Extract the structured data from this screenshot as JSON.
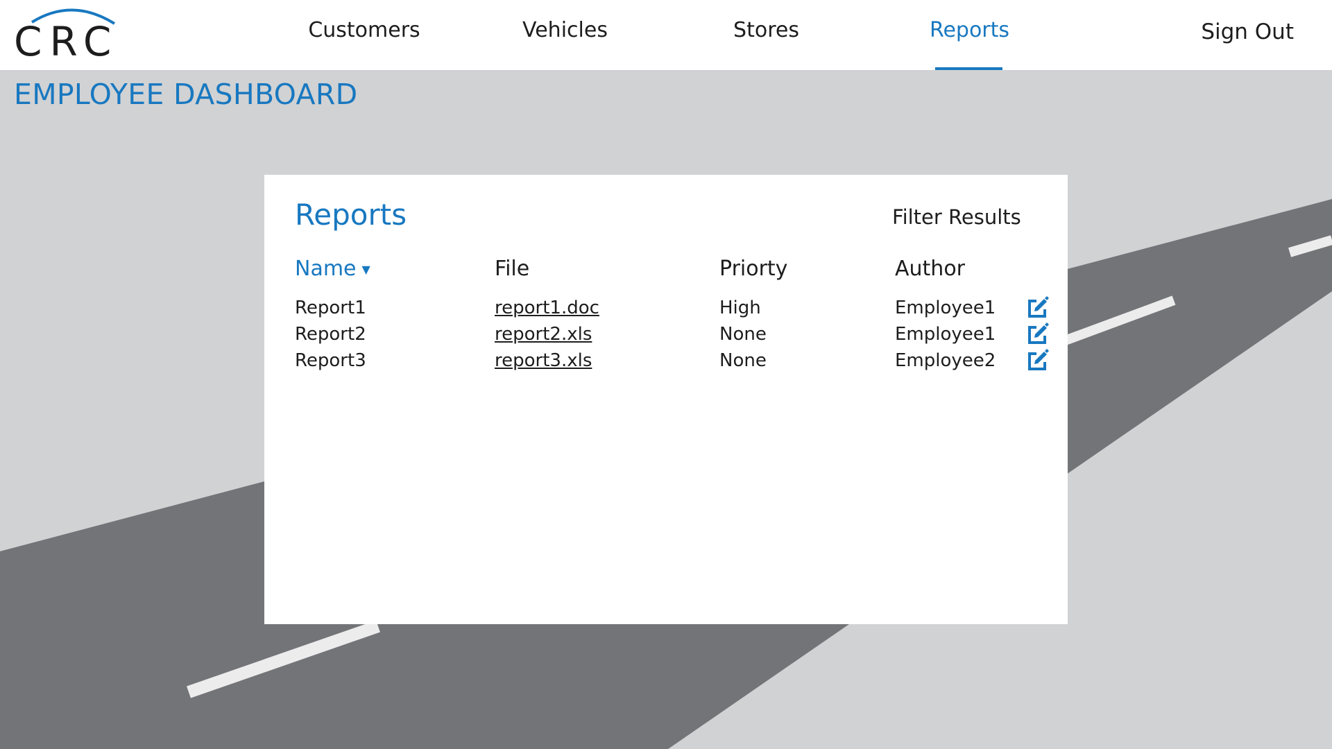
{
  "app": {
    "logo_text": "CRC"
  },
  "nav": {
    "items": [
      {
        "label": "Customers",
        "active": false
      },
      {
        "label": "Vehicles",
        "active": false
      },
      {
        "label": "Stores",
        "active": false
      },
      {
        "label": "Reports",
        "active": true
      }
    ],
    "sign_out": "Sign Out"
  },
  "page": {
    "title": "EMPLOYEE DASHBOARD"
  },
  "reports": {
    "title": "Reports",
    "filter_label": "Filter Results",
    "columns": [
      "Name",
      "File",
      "Priorty",
      "Author"
    ],
    "sort_indicator": "▼",
    "rows": [
      {
        "name": "Report1",
        "file": "report1.doc",
        "priority": "High",
        "author": "Employee1",
        "action_icon": "edit-icon"
      },
      {
        "name": "Report2",
        "file": "report2.xls",
        "priority": "None",
        "author": "Employee1",
        "action_icon": "edit-icon"
      },
      {
        "name": "Report3",
        "file": "report3.xls",
        "priority": "None",
        "author": "Employee2",
        "action_icon": "edit-icon"
      }
    ]
  },
  "colors": {
    "accent": "#1878c0",
    "background": "#d1d2d4",
    "road": "#737478",
    "road_marking": "#ececec",
    "text": "#1d1d1d",
    "surface": "#ffffff"
  }
}
